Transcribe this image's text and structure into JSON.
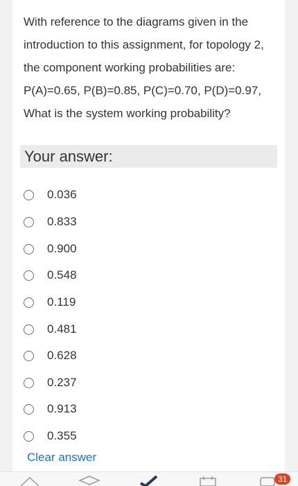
{
  "question": {
    "lines": [
      "With reference to the diagrams given in the",
      "introduction to this assignment, for topology 2,",
      "the component working probabilities are:",
      "P(A)=0.65, P(B)=0.85, P(C)=0.70, P(D)=0.97,",
      "What is the system working probability?"
    ]
  },
  "answer_label": "Your answer:",
  "options": [
    "0.036",
    "0.833",
    "0.900",
    "0.548",
    "0.119",
    "0.481",
    "0.628",
    "0.237",
    "0.913",
    "0.355"
  ],
  "clear_label": "Clear answer",
  "nav": {
    "badge_count": "31",
    "icons": [
      "home-icon",
      "graduation-cap-icon",
      "checkmark-icon",
      "calendar-icon",
      "inbox-icon"
    ]
  },
  "colors": {
    "link": "#1a73c7",
    "badge": "#e2401c",
    "answer_box": "#ebebeb"
  }
}
